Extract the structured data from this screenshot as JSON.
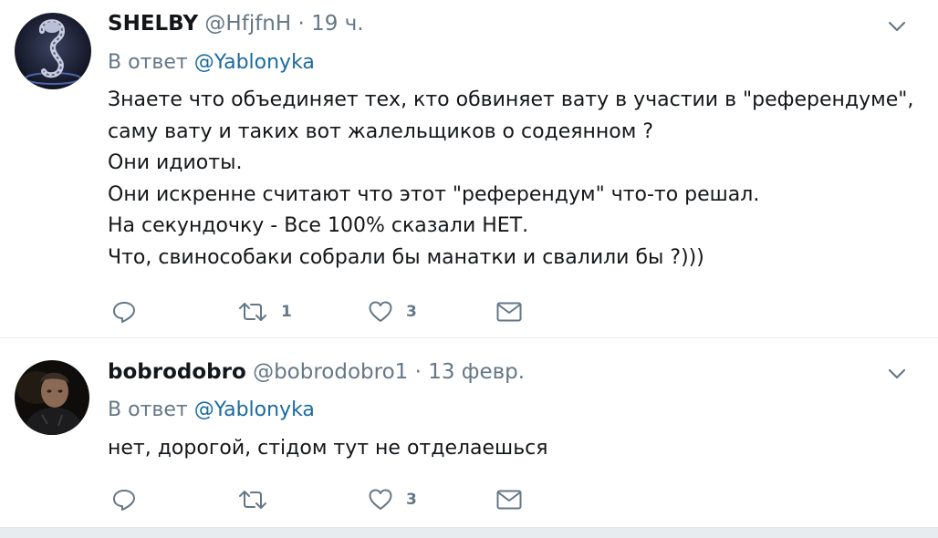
{
  "colors": {
    "name": "#14171a",
    "meta": "#657786",
    "mention": "#1b6aa1",
    "divider": "#e6ecf0"
  },
  "tweets": [
    {
      "display_name": "SHELBY",
      "handle": "@HfjfnH",
      "separator": "·",
      "time": "19 ч.",
      "reply_prefix": "В ответ",
      "reply_mention": "@Yablonyka",
      "lines": [
        "Знаете что объединяет тех, кто обвиняет вату в участии в \"референдуме\",",
        "саму вату и таких вот жалельщиков о содеянном ?",
        "Они идиоты.",
        "Они искренне считают что этот \"референдум\" что-то решал.",
        "На секундочку - Все 100% сказали НЕТ.",
        "Что, свинособаки собрали бы манатки и свалили бы ?)))"
      ],
      "actions": {
        "reply_icon": "reply-icon",
        "retweet_icon": "retweet-icon",
        "retweet_count": "1",
        "like_icon": "heart-icon",
        "like_count": "3",
        "dm_icon": "envelope-icon"
      }
    },
    {
      "display_name": "bobrodobro",
      "handle": "@bobrodobro1",
      "separator": "·",
      "time": "13 февр.",
      "reply_prefix": "В ответ",
      "reply_mention": "@Yablonyka",
      "lines": [
        "нет, дорогой, стідом тут не отделаешься"
      ],
      "actions": {
        "reply_icon": "reply-icon",
        "retweet_icon": "retweet-icon",
        "retweet_count": "",
        "like_icon": "heart-icon",
        "like_count": "3",
        "dm_icon": "envelope-icon"
      }
    }
  ]
}
